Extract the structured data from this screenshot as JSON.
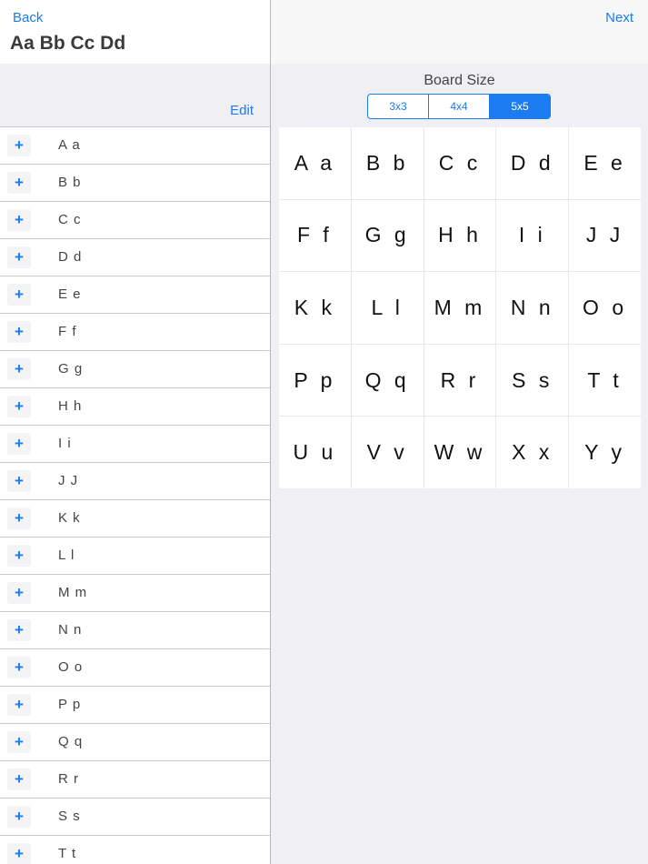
{
  "nav": {
    "back_label": "Back",
    "title": "Aa Bb Cc Dd",
    "edit_label": "Edit",
    "next_label": "Next"
  },
  "list": {
    "items": [
      "A a",
      "B b",
      "C c",
      "D d",
      "E e",
      "F f",
      "G g",
      "H h",
      "I i",
      "J J",
      "K k",
      "L l",
      "M m",
      "N n",
      "O o",
      "P p",
      "Q q",
      "R r",
      "S s",
      "T t"
    ],
    "add_symbol": "+"
  },
  "board": {
    "label": "Board Size",
    "sizes": [
      "3x3",
      "4x4",
      "5x5"
    ],
    "selected": "5x5",
    "cells": [
      "A a",
      "B b",
      "C c",
      "D d",
      "E e",
      "F f",
      "G g",
      "H h",
      "I i",
      "J J",
      "K k",
      "L l",
      "M m",
      "N n",
      "O o",
      "P p",
      "Q q",
      "R r",
      "S s",
      "T t",
      "U u",
      "V v",
      "W w",
      "X x",
      "Y y"
    ]
  },
  "colors": {
    "accent": "#1a7cf0",
    "panel_bg": "#efeff4",
    "separator": "#c8c7cc"
  }
}
